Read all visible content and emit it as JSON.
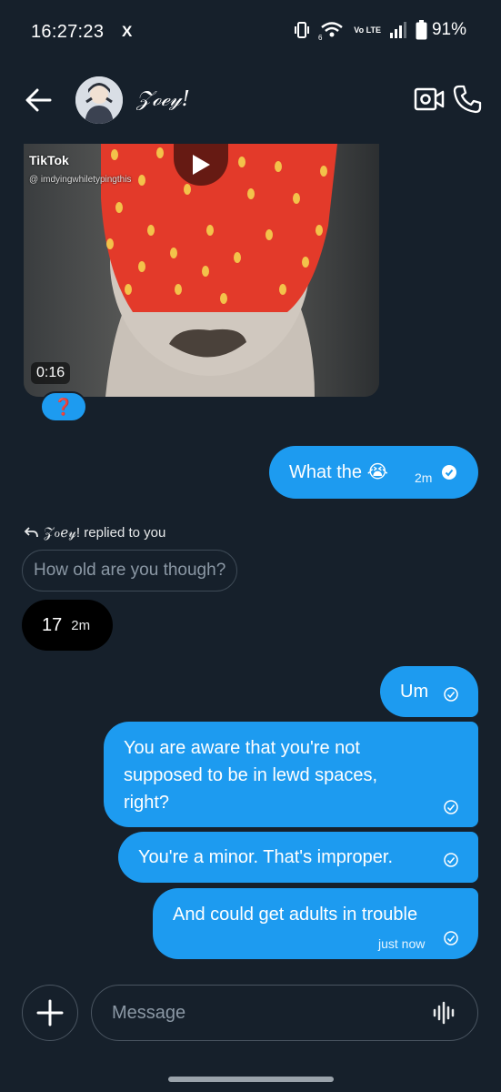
{
  "status_bar": {
    "time": "16:27:23",
    "x_badge": "X",
    "volte": "Vo LTE",
    "battery": "91%"
  },
  "header": {
    "contact_name": "𝒵ℴℯ𝓎!",
    "back_icon": "arrow-left-icon",
    "video_icon": "video-camera-icon",
    "call_icon": "phone-icon"
  },
  "video": {
    "source": "TikTok",
    "username": "@ imdyingwhiletypingthis",
    "duration": "0:16",
    "reaction": "❓"
  },
  "messages": {
    "m1_text": "What the 😭",
    "m1_time": "2m",
    "reply_label": "𝒵ℴℯ𝓎! replied to you",
    "quoted_text": "How old are you though?",
    "in_text": "17",
    "in_time": "2m",
    "m2_text": "Um",
    "m3_text": "You are aware that you're not supposed to be in lewd spaces, right?",
    "m4_text": "You're a minor. That's improper.",
    "m5_text": "And could get adults in trouble",
    "m5_time": "just now"
  },
  "composer": {
    "placeholder": "Message"
  },
  "colors": {
    "background": "#16202b",
    "outgoing_bubble": "#1d9bf0",
    "incoming_bubble": "#000000"
  }
}
